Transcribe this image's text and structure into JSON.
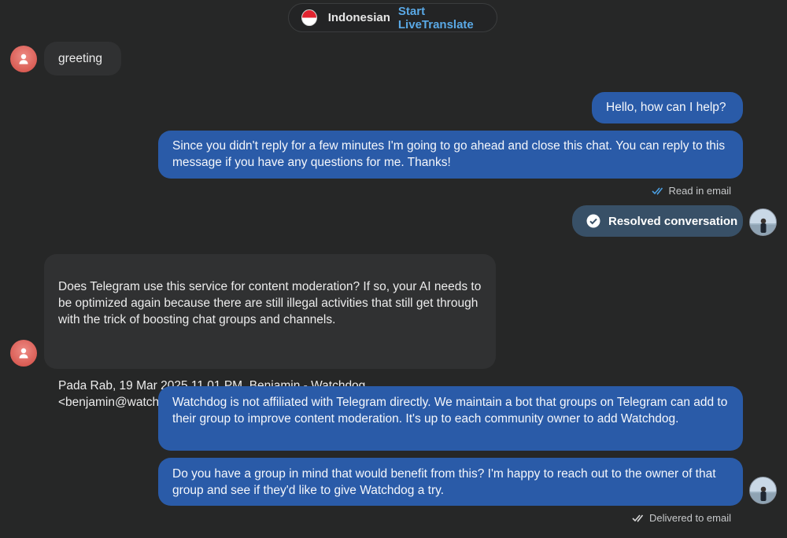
{
  "language_bar": {
    "flag_icon": "indonesia-flag-icon",
    "language": "Indonesian",
    "action": "Start LiveTranslate"
  },
  "messages": [
    {
      "from": "user",
      "text": "greeting"
    },
    {
      "from": "agent",
      "text": "Hello, how can I help?"
    },
    {
      "from": "agent",
      "text": "Since you didn't reply for a few minutes I'm going to go ahead and close this chat. You can reply to this message if you have any questions for me. Thanks!"
    },
    {
      "from": "user",
      "text": "Does Telegram use this service for content moderation? If so, your AI needs to be optimized again because there are still illegal activities that still get through with the trick of boosting chat groups and channels.",
      "quote": "Pada Rab, 19 Mar 2025 11.01 PM, Benjamin - Watchdog <benjamin@watchdog.on.crisp.email> menulis:"
    },
    {
      "from": "agent",
      "text": "Watchdog is not affiliated with Telegram directly. We maintain a bot that groups on Telegram can add to their group to improve content moderation. It's up to each community owner to add Watchdog."
    },
    {
      "from": "agent",
      "text": "Do you have a group in mind that would benefit from this? I'm happy to reach out to the owner of that group and see if they'd like to give Watchdog a try."
    }
  ],
  "read_status": "Read in email",
  "resolved_label": "Resolved conversation",
  "delivered_status": "Delivered to email",
  "colors": {
    "background": "#262727",
    "agent_bubble": "#2a5ba8",
    "user_bubble": "#303132",
    "resolved_bubble": "#385067",
    "link": "#5aa9e6",
    "user_avatar": "#e07068"
  }
}
